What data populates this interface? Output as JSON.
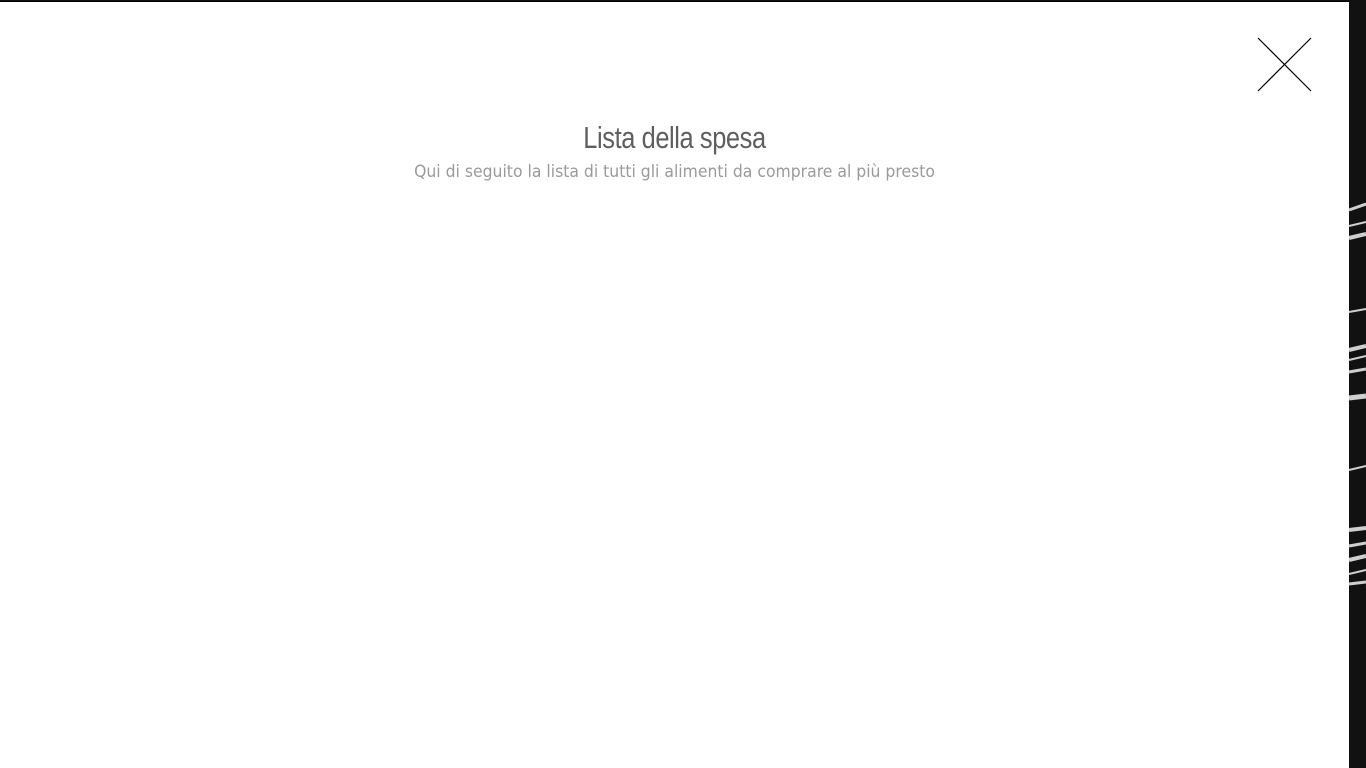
{
  "modal": {
    "title": "Lista della spesa",
    "subtitle": "Qui di seguito la lista di tutti gli alimenti da comprare al più presto",
    "close_icon": "close-icon"
  },
  "colors": {
    "modal_background": "#ffffff",
    "title": "#5f5f5f",
    "subtitle": "#9a9a9a",
    "backdrop": "#111111"
  }
}
